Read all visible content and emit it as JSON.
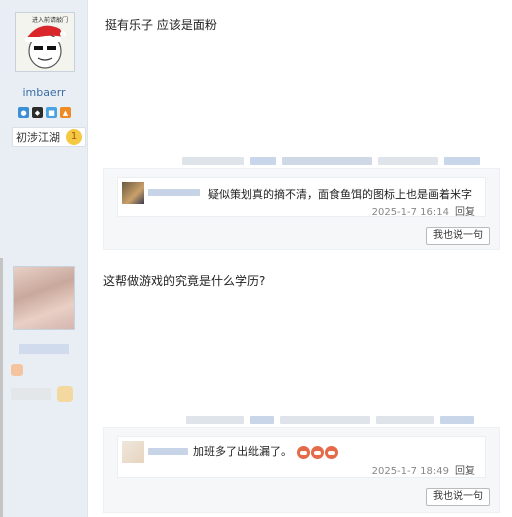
{
  "posts": [
    {
      "username": "imbaerr",
      "avatar_text": "进入前请敲门",
      "rank_label": "初涉江湖",
      "rank_level": "1",
      "content": "挺有乐子 应该是面粉",
      "comment": {
        "text": "疑似策划真的摘不清，面食鱼饵的图标上也是画着米字",
        "time": "2025-1-7 16:14",
        "reply_label": "回复"
      },
      "say_button": "我也说一句"
    },
    {
      "username": "",
      "content": "这帮做游戏的究竟是什么学历?",
      "comment": {
        "text": "加班多了出纰漏了。",
        "time": "2025-1-7 18:49",
        "reply_label": "回复"
      },
      "say_button": "我也说一句"
    }
  ],
  "colors": {
    "sidebar_bg": "#e8eef4",
    "link_blue": "#3a6ea5",
    "comment_box_bg": "#f5f7f9"
  },
  "icons": [
    "santa-hat-avatar",
    "badge-blue",
    "badge-black",
    "badge-blue-2",
    "badge-orange",
    "rank-star-icon",
    "angry-face-icon"
  ]
}
